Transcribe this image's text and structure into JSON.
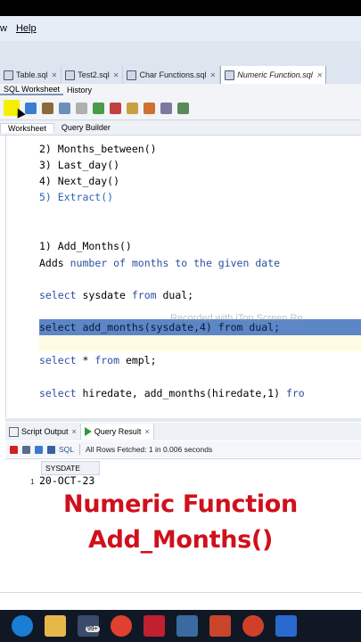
{
  "menu": {
    "edge": "w",
    "help": "Help"
  },
  "editor_tabs": [
    {
      "label": "Table.sql"
    },
    {
      "label": "Test2.sql"
    },
    {
      "label": "Char Functions.sql"
    },
    {
      "label": "Numeric Function.sql"
    }
  ],
  "sub_tabs": {
    "worksheet": "SQL Worksheet",
    "history": "History"
  },
  "ws_tabs": {
    "worksheet": "Worksheet",
    "query_builder": "Query Builder"
  },
  "code": {
    "l1": "2) Months_between()",
    "l2": "3) Last_day()",
    "l3": "4) Next_day()",
    "l4": "5) Extract()",
    "l5": "1) Add_Months()",
    "l6a": "Adds ",
    "l6b": "number of months to the given date",
    "l7a": "select",
    "l7b": " sysdate ",
    "l7c": "from",
    "l7d": " dual;",
    "l8": "select add_months(sysdate,4) from dual;",
    "l9a": "select",
    "l9b": " * ",
    "l9c": "from",
    "l9d": " empl;",
    "l10a": "select",
    "l10b": " hiredate, add_months(hiredate,1) ",
    "l10c": "fro"
  },
  "watermark": "Recorded with iTop Screen Re",
  "output_tabs": {
    "script_output": "Script Output",
    "query_result": "Query Result"
  },
  "output_bar": {
    "sql": "SQL",
    "status": "All Rows Fetched: 1 in 0.006 seconds"
  },
  "result": {
    "column": "SYSDATE",
    "row_num": "1",
    "value": "20-OCT-23"
  },
  "caption": {
    "line1": "Numeric Function",
    "line2": "Add_Months()"
  },
  "taskbar": {
    "badge": "99+"
  },
  "colors": {
    "accent": "#d0101c",
    "highlight": "#5c86c5",
    "keyword": "#2c4fa0"
  }
}
